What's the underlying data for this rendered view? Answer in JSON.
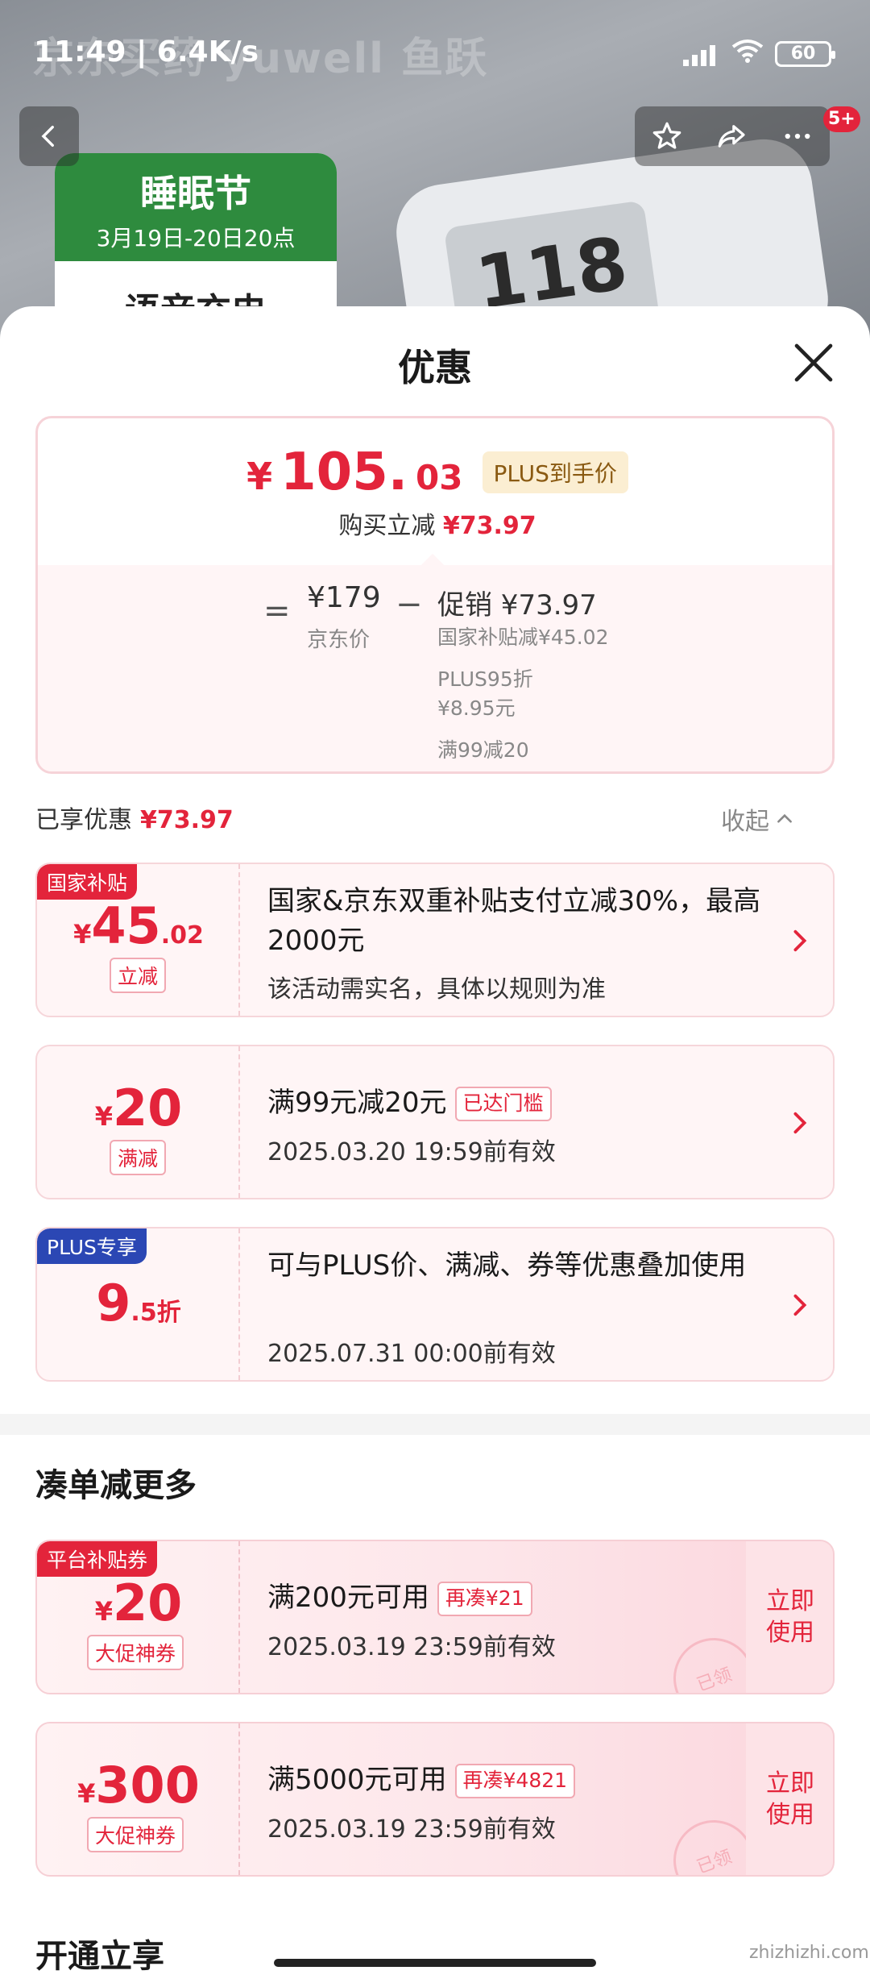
{
  "status_bar": {
    "time": "11:49 | 6.4K/s",
    "battery": "60"
  },
  "background": {
    "brand_text": "京东买药  yuwell 鱼跃",
    "promo_title": "睡眠节",
    "promo_date": "3月19日-20日20点",
    "promo_body": "语音充电",
    "device_screen": "118"
  },
  "nav": {
    "badge": "5+"
  },
  "sheet": {
    "title": "优惠"
  },
  "price_card": {
    "yen": "¥",
    "price_int": "105.",
    "price_dec": "03",
    "plus_tag": "PLUS到手价",
    "sub_label": "购买立减",
    "sub_value": "¥73.97",
    "eq": "=",
    "jd_price": "¥179",
    "jd_label": "京东价",
    "minus": "−",
    "promo": "促销 ¥73.97",
    "details": [
      "国家补贴减¥45.02",
      "PLUS95折",
      "¥8.95元",
      "满99减20"
    ]
  },
  "enjoyed": {
    "label": "已享优惠",
    "value": "¥73.97",
    "collapse": "收起"
  },
  "coupons": [
    {
      "corner": "国家补贴",
      "yen": "¥",
      "amount": "45",
      "dec": ".02",
      "type": "立减",
      "title": "国家&京东双重补贴支付立减30%，最高2000元",
      "desc": "该活动需实名，具体以规则为准"
    },
    {
      "yen": "¥",
      "amount": "20",
      "type": "满减",
      "title": "满99元减20元",
      "tag": "已达门槛",
      "desc": "2025.03.20 19:59前有效"
    },
    {
      "corner": "PLUS专享",
      "amount": "9",
      "dec": ".5折",
      "title": "可与PLUS价、满减、券等优惠叠加使用",
      "desc": "2025.07.31 00:00前有效"
    }
  ],
  "section": {
    "title": "凑单减更多",
    "next_title": "开通立享"
  },
  "promo_coupons": [
    {
      "corner": "平台补贴券",
      "yen": "¥",
      "amount": "20",
      "type": "大促神券",
      "title": "满200元可用",
      "tag": "再凑¥21",
      "desc": "2025.03.19 23:59前有效",
      "action": "立即使用",
      "stamp": "已领"
    },
    {
      "yen": "¥",
      "amount": "300",
      "type": "大促神券",
      "title": "满5000元可用",
      "tag": "再凑¥4821",
      "desc": "2025.03.19 23:59前有效",
      "action": "立即使用",
      "stamp": "已领"
    }
  ],
  "watermark": "zhizhizhi.com"
}
